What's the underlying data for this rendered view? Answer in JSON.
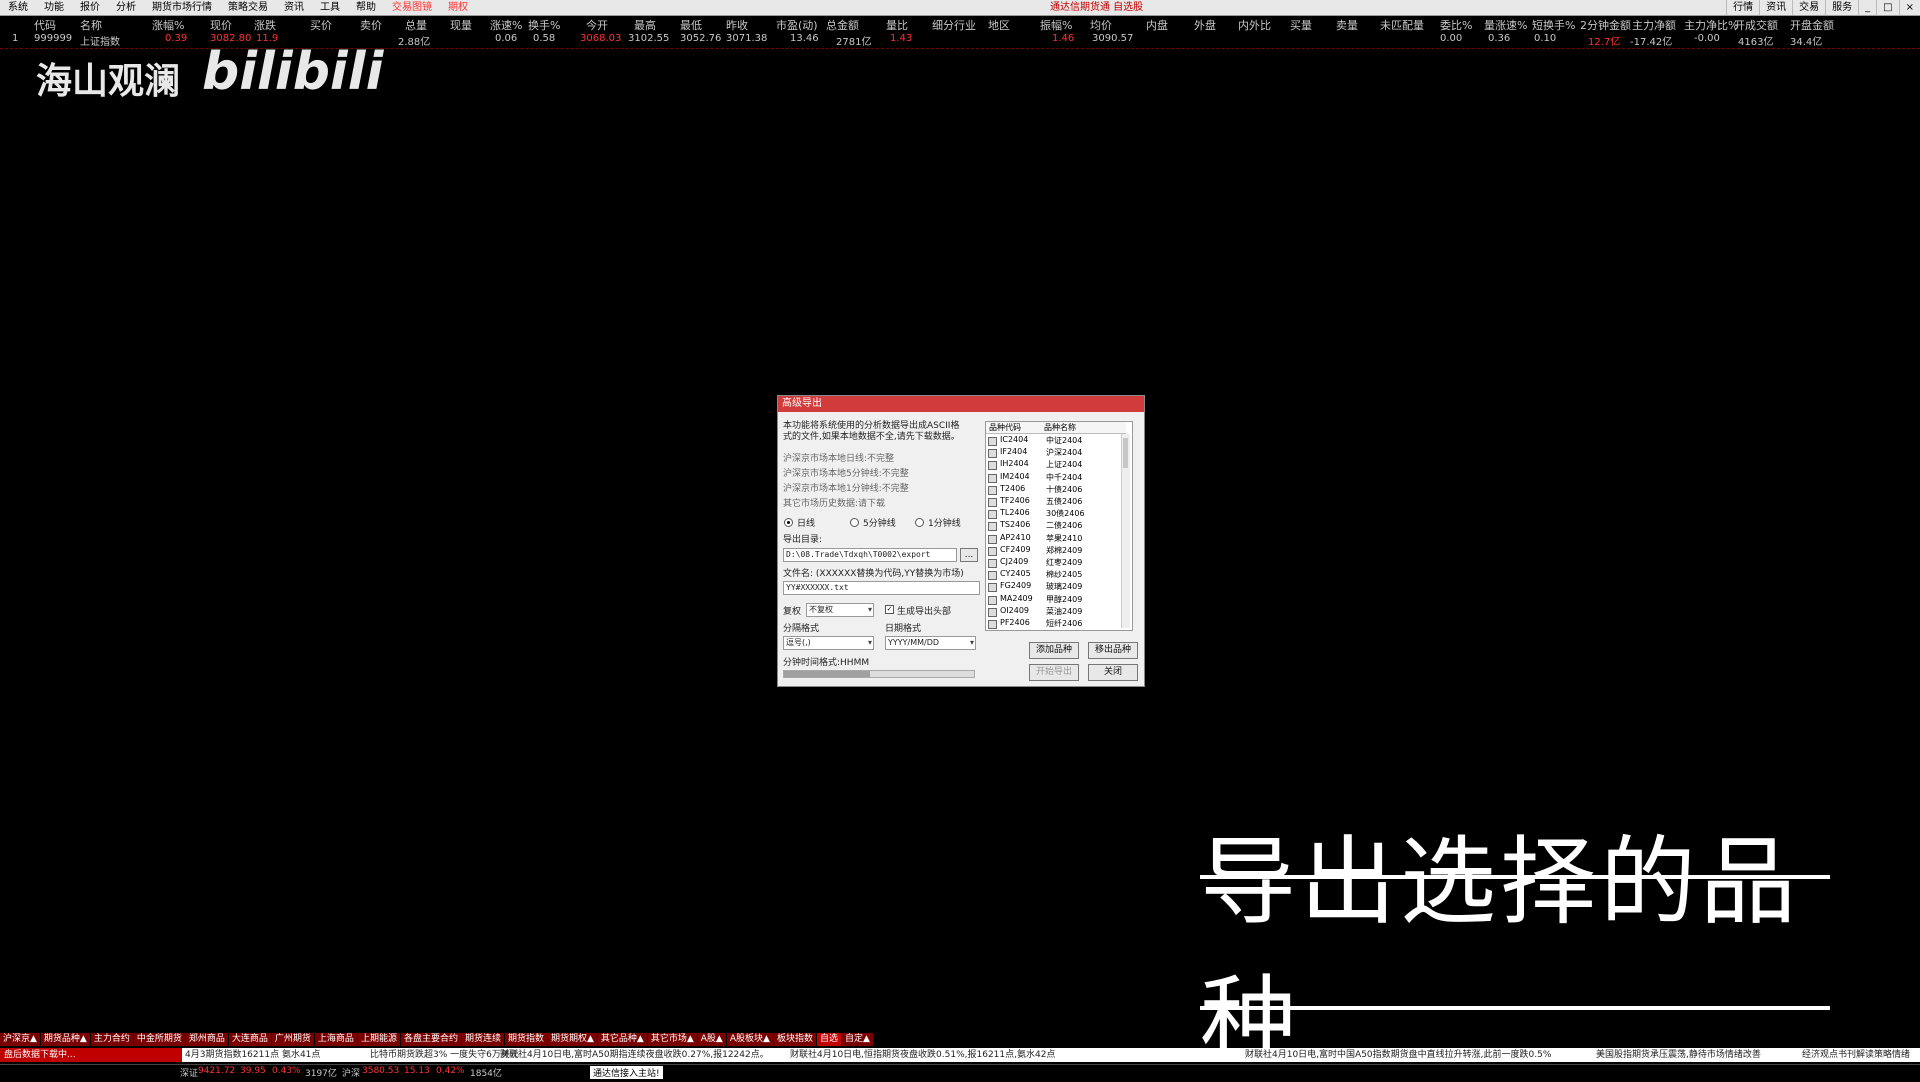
{
  "menubar": {
    "items": [
      "系统",
      "功能",
      "报价",
      "分析",
      "期货市场行情",
      "策略交易",
      "资讯",
      "工具",
      "帮助",
      "交易图镜",
      "期权"
    ],
    "center_title": "通达信期货通 自选股",
    "right_items": [
      "行情",
      "资讯",
      "交易",
      "服务"
    ]
  },
  "table": {
    "headers": [
      "代码",
      "名称",
      "涨幅%",
      "现价",
      "涨跌",
      "买价",
      "卖价",
      "总量",
      "现量",
      "涨速%",
      "换手%",
      "今开",
      "最高",
      "最低",
      "昨收",
      "市盈(动)",
      "总金额",
      "量比",
      "细分行业",
      "地区",
      "振幅%",
      "均价",
      "内盘",
      "外盘",
      "内外比",
      "买量",
      "卖量",
      "未匹配量",
      "委比%",
      "量涨速%",
      "短换手%",
      "2分钟金额",
      "主力净额",
      "主力净比%",
      "开成交额",
      "开盘金额"
    ],
    "row": [
      "1",
      "999999",
      "上证指数",
      "0.39",
      "3082.80",
      "11.9",
      "",
      "",
      "2.88亿",
      "",
      "0.06",
      "0.58",
      "3068.03",
      "3102.55",
      "3052.76",
      "3071.38",
      "13.46",
      "2781亿",
      "1.43",
      "",
      "",
      "1.46",
      "3090.57",
      "",
      "",
      "",
      "",
      "",
      "",
      "0.00",
      "0.36",
      "0.10",
      "12.7亿",
      "-17.42亿",
      "-0.00",
      "4163亿",
      "34.4亿"
    ]
  },
  "watermark": {
    "name": "海山观澜",
    "brand": "bilibili"
  },
  "caption": "导出选择的品种",
  "dialog": {
    "title": "高级导出",
    "desc_line1": "本功能将系统使用的分析数据导出成ASCII格",
    "desc_line2": "式的文件,如果本地数据不全,请先下载数据。",
    "status1": "沪深京市场本地日线:不完整",
    "status2": "沪深京市场本地5分钟线:不完整",
    "status3": "沪深京市场本地1分钟线:不完整",
    "status4": "其它市场历史数据:请下载",
    "radio_day": "日线",
    "radio_5min": "5分钟线",
    "radio_1min": "1分钟线",
    "export_dir_label": "导出目录:",
    "export_dir": "D:\\08.Trade\\Tdxqh\\T0002\\export",
    "browse": "...",
    "filename_label": "文件名: (XXXXXX替换为代码,YY替换为市场)",
    "filename": "YY#XXXXXX.txt",
    "fuquan_label": "复权",
    "fuquan_value": "不复权",
    "header_check": "生成导出头部",
    "sep_label": "分隔格式",
    "sep_value": "逗号(,)",
    "date_label": "日期格式",
    "date_value": "YYYY/MM/DD",
    "time_format": "分钟时间格式:HHMM",
    "progress": 0.45,
    "list_header_code": "品种代码",
    "list_header_name": "品种名称",
    "list": [
      {
        "code": "IC2404",
        "name": "中证2404"
      },
      {
        "code": "IF2404",
        "name": "沪深2404"
      },
      {
        "code": "IH2404",
        "name": "上证2404"
      },
      {
        "code": "IM2404",
        "name": "中千2404"
      },
      {
        "code": "T2406",
        "name": "十债2406"
      },
      {
        "code": "TF2406",
        "name": "五债2406"
      },
      {
        "code": "TL2406",
        "name": "30债2406"
      },
      {
        "code": "TS2406",
        "name": "二债2406"
      },
      {
        "code": "AP2410",
        "name": "苹果2410"
      },
      {
        "code": "CF2409",
        "name": "郑棉2409"
      },
      {
        "code": "CJ2409",
        "name": "红枣2409"
      },
      {
        "code": "CY2405",
        "name": "棉纱2405"
      },
      {
        "code": "FG2409",
        "name": "玻璃2409"
      },
      {
        "code": "MA2409",
        "name": "甲醇2409"
      },
      {
        "code": "OI2409",
        "name": "菜油2409"
      },
      {
        "code": "PF2406",
        "name": "短纤2406"
      }
    ],
    "add_btn": "添加品种",
    "remove_btn": "移出品种",
    "start_btn": "开始导出",
    "close_btn": "关闭"
  },
  "tabs": [
    "沪深京▲",
    "期货品种▲",
    "主力合约",
    "中金所期货",
    "郑州商品",
    "大连商品",
    "广州期货",
    "上海商品",
    "上期能源",
    "各盘主要合约",
    "期货连续",
    "期货指数",
    "期货期权▲",
    "其它品种▲",
    "其它市场▲",
    "A股▲",
    "A股板块▲",
    "板块指数",
    "自选",
    "自定▲"
  ],
  "ticker": {
    "status": "盘后数据下载中...",
    "news1": "4月3期货指数16211点 氨水41点",
    "news2": "比特币期货跌超3% 一度失守6万美元",
    "news3": "财联社4月10日电,富时A50期指连续夜盘收跌0.27%,报12242点。",
    "news4": "财联社4月10日电,恒指期货夜盘收跌0.51%,报16211点,氨水42点",
    "news5": "财联社4月10日电,富时中国A50指数期货盘中直线拉升转涨,此前一度跌0.5%",
    "news6": "美国股指期货承压震荡,静待市场情绪改善",
    "news7": "经济观点书刊解读策略情绪"
  },
  "index_bar": {
    "a_label": "深证",
    "a_value": "9421.72",
    "a_change": "39.95",
    "a_pct": "0.43%",
    "a_amount": "3197亿",
    "b_label": "沪深",
    "b_value": "3580.53",
    "b_change": "15.13",
    "b_pct": "0.42%",
    "b_amount": "1854亿",
    "msg": "通达信接入主站!"
  }
}
